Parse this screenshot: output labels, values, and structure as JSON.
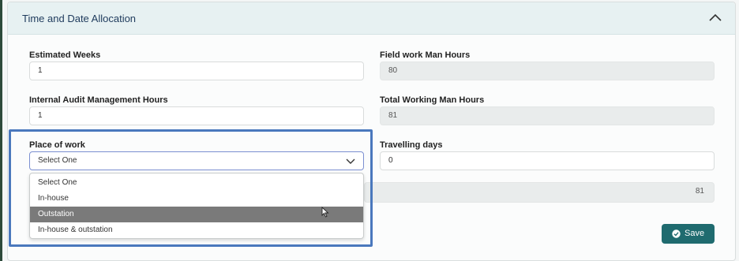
{
  "section": {
    "title": "Time and Date Allocation",
    "collapse_icon": "chevron-up-icon"
  },
  "fields": {
    "estimated_weeks": {
      "label": "Estimated Weeks",
      "value": "1"
    },
    "field_work_man_hours": {
      "label": "Field work Man Hours",
      "value": "80"
    },
    "internal_audit_management_hours": {
      "label": "Internal Audit Management Hours",
      "value": "1"
    },
    "total_working_man_hours": {
      "label": "Total Working Man Hours",
      "value": "81"
    },
    "place_of_work": {
      "label": "Place of work",
      "selected": "Select One",
      "options": [
        "Select One",
        "In-house",
        "Outstation",
        "In-house & outstation"
      ],
      "hovered_option": "Outstation"
    },
    "travelling_days": {
      "label": "Travelling days",
      "value": "0"
    },
    "partial_total": {
      "value": "81"
    }
  },
  "actions": {
    "save_label": "Save",
    "save_icon": "check-circle-icon"
  },
  "colors": {
    "header_bg": "#e7f1f2",
    "title_text": "#1e3a5c",
    "save_button": "#1f6b6f",
    "highlight_border": "#4a78bd",
    "hover_option": "#7a7a7a"
  }
}
